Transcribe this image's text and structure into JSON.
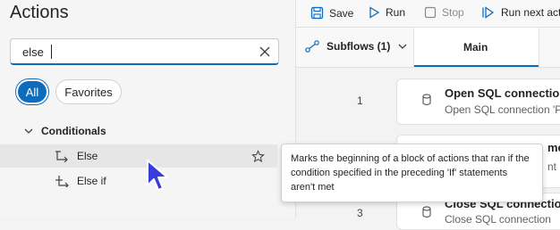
{
  "actions_panel": {
    "title": "Actions",
    "search": {
      "value": "else"
    },
    "filters": {
      "all": "All",
      "favorites": "Favorites"
    },
    "group": "Conditionals",
    "items": [
      {
        "label": "Else"
      },
      {
        "label": "Else if"
      }
    ]
  },
  "toolbar": {
    "save": "Save",
    "run": "Run",
    "stop": "Stop",
    "run_next": "Run next act"
  },
  "tabs": {
    "subflows": "Subflows (1)",
    "main": "Main"
  },
  "flow": {
    "steps": [
      {
        "line": "1",
        "title": "Open SQL connection",
        "subtitle": "Open SQL connection 'P"
      },
      {
        "line": "",
        "title": "me",
        "subtitle": "nt 's"
      },
      {
        "line": "3",
        "title": "Close SQL connection",
        "subtitle": "Close SQL connection"
      }
    ]
  },
  "tooltip": {
    "text": "Marks the beginning of a block of actions that ran if the condition specified in the preceding 'If' statements aren't met"
  },
  "colors": {
    "accent": "#0f6cbd"
  }
}
